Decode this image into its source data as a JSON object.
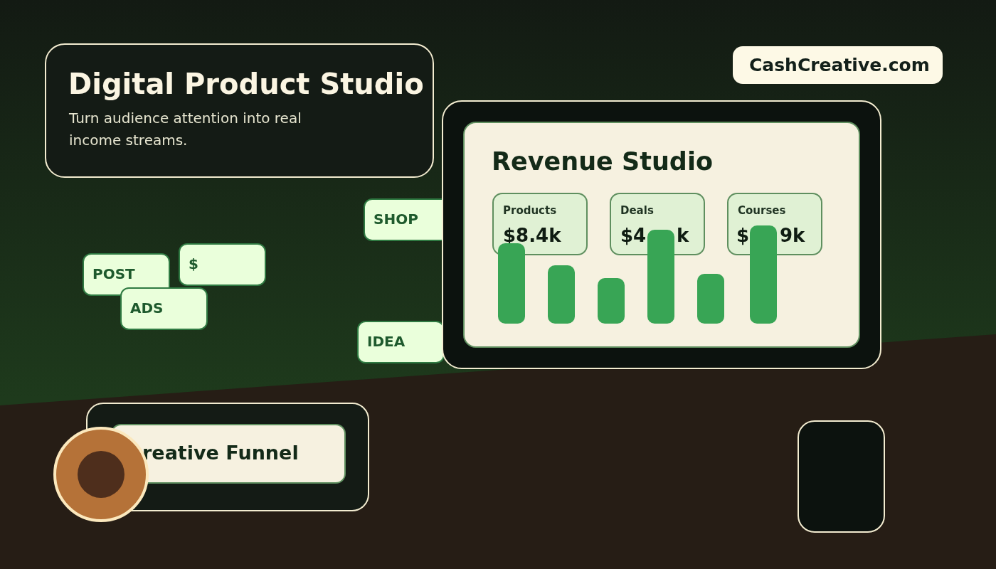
{
  "header": {
    "title": "Digital Product Studio",
    "subtitle": "Turn audience attention into real income streams."
  },
  "brand": {
    "label": "CashCreative.com"
  },
  "tags": [
    {
      "label": "SHOP"
    },
    {
      "label": "POST"
    },
    {
      "label": "$"
    },
    {
      "label": "ADS"
    },
    {
      "label": "IDEA"
    }
  ],
  "dashboard": {
    "title": "Revenue Studio",
    "stats": [
      {
        "label": "Products",
        "value_parts": [
          "$8.4k"
        ]
      },
      {
        "label": "Deals",
        "value_parts": [
          "$4",
          "k"
        ]
      },
      {
        "label": "Courses",
        "value_parts": [
          "$",
          "9k"
        ]
      }
    ]
  },
  "funnel": {
    "label": "reative Funnel"
  }
}
